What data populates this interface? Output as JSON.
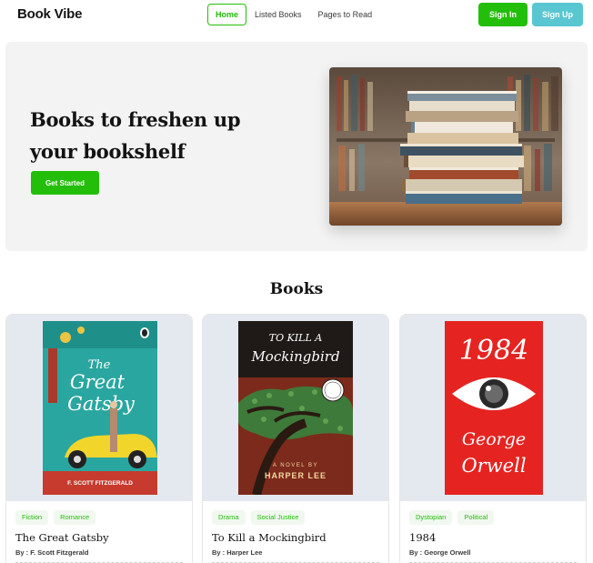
{
  "navbar": {
    "brand": "Book Vibe",
    "links": [
      "Home",
      "Listed Books",
      "Pages to Read"
    ],
    "active_link": "Home",
    "sign_in": "Sign In",
    "sign_up": "Sign Up"
  },
  "hero": {
    "title_line1": "Books to freshen up",
    "title_line2": "your bookshelf",
    "cta": "Get Started"
  },
  "books_section": {
    "title": "Books",
    "books": [
      {
        "tags": [
          "Fiction",
          "Romance"
        ],
        "title": "The Great Gatsby",
        "author": "By : F. Scott Fitzgerald",
        "cover": {
          "line1": "The",
          "line2": "Great",
          "line3": "Gatsby",
          "byline": "F. SCOTT FITZGERALD"
        }
      },
      {
        "tags": [
          "Drama",
          "Social Justice"
        ],
        "title": "To Kill a Mockingbird",
        "author": "By : Harper Lee",
        "cover": {
          "line1": "TO KILL A",
          "line2": "Mockingbird",
          "subtitle": "A NOVEL BY",
          "author": "HARPER LEE"
        }
      },
      {
        "tags": [
          "Dystopian",
          "Political"
        ],
        "title": "1984",
        "author": "By : George Orwell",
        "cover": {
          "line1": "1984",
          "line2": "George",
          "line3": "Orwell"
        }
      }
    ]
  },
  "colors": {
    "accent_green": "#23be0a",
    "accent_cyan": "#59c6d2",
    "hero_bg": "#f3f3f3",
    "tag_bg": "#f0f8ef",
    "cover_bg": "#e4e9ef"
  }
}
